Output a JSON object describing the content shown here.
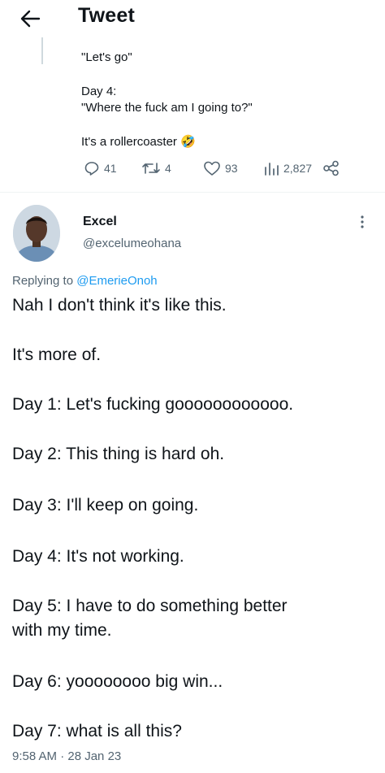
{
  "header": {
    "title": "Tweet"
  },
  "quoted": {
    "lines": [
      "\"Let's go\"",
      "Day 4:",
      "\"Where the fuck am I going to?\"",
      "It's a rollercoaster 🤣"
    ],
    "stats": {
      "replies": "41",
      "retweets": "4",
      "likes": "93",
      "views": "2,827"
    }
  },
  "reply": {
    "name": "Excel",
    "handle": "@excelumeohana",
    "replying_prefix": "Replying to",
    "replying_to": "@EmerieOnoh",
    "lines": [
      "Nah I don't think it's like this.",
      "It's more of.",
      "Day 1: Let's fucking goooooooooooo.",
      "Day 2: This thing is hard oh.",
      "Day 3: I'll keep on going.",
      "Day 4: It's not working.",
      "Day 5: I have to do something better",
      "with my time.",
      "Day 6: yoooooooo big win...",
      "Day 7: what is all this?"
    ],
    "timestamp": "9:58 AM · 28 Jan 23"
  },
  "colors": {
    "text": "#0f1419",
    "secondary": "#536471",
    "accent": "#1d9bf0",
    "line": "#cfd9de"
  },
  "icons": [
    "back-arrow-icon",
    "reply-icon",
    "retweet-icon",
    "like-icon",
    "views-icon",
    "share-icon",
    "more-icon"
  ]
}
